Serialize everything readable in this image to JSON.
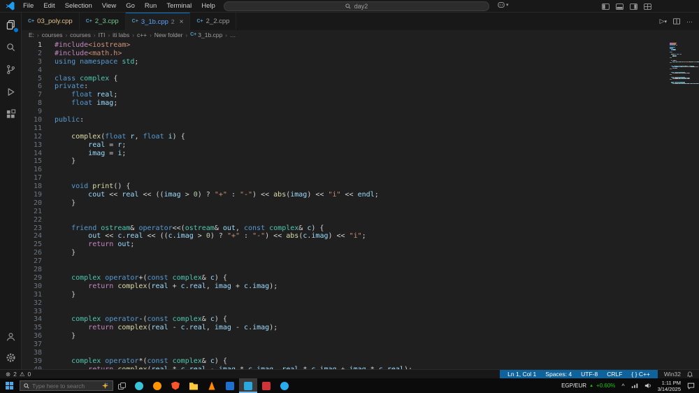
{
  "colors": {
    "accent": "#0078d4",
    "status_section": "#0e639c",
    "ticker_up": "#16c60c",
    "error": "#f14c4c",
    "warning": "#cca700"
  },
  "syntax_colors": {
    "k": "#569CD6",
    "c": "#C586C0",
    "t": "#4EC9B0",
    "v": "#9CDCFE",
    "f": "#DCDCAA",
    "s": "#CE9178",
    "n": "#B5CEA8",
    "p": "#D4D4D4"
  },
  "menu_bar": {
    "items": [
      "File",
      "Edit",
      "Selection",
      "View",
      "Go",
      "Run",
      "Terminal",
      "Help"
    ]
  },
  "command_center": {
    "value": "day2"
  },
  "tabs": [
    {
      "label": "03_poly.cpp",
      "color": "#e2c08d",
      "active": false
    },
    {
      "label": "2_3.cpp",
      "color": "#73c991",
      "active": false
    },
    {
      "label": "3_1b.cpp",
      "suffix": "2",
      "color": "#58a6ff",
      "active": true,
      "close": "×"
    },
    {
      "label": "2_2.cpp",
      "color": "#9d9d9d",
      "active": false
    }
  ],
  "breadcrumb": {
    "items": [
      "E:",
      "courses",
      "courses",
      "ITI",
      "iti labs",
      "c++",
      "New folder",
      "3_1b.cpp",
      "…"
    ],
    "file_index": 7
  },
  "editor": {
    "lines": [
      [
        [
          "#include",
          "c"
        ],
        [
          "<iostream>",
          "s"
        ]
      ],
      [
        [
          "#include",
          "c"
        ],
        [
          "<math.h>",
          "s"
        ]
      ],
      [
        [
          "using",
          "k"
        ],
        [
          " ",
          "p"
        ],
        [
          "namespace",
          "k"
        ],
        [
          " ",
          "p"
        ],
        [
          "std",
          "t"
        ],
        [
          ";",
          "p"
        ]
      ],
      [],
      [
        [
          "class",
          "k"
        ],
        [
          " ",
          "p"
        ],
        [
          "complex",
          "t"
        ],
        [
          " {",
          "p"
        ]
      ],
      [
        [
          "private",
          "k"
        ],
        [
          ":",
          "p"
        ]
      ],
      [
        [
          "    ",
          "p"
        ],
        [
          "float",
          "k"
        ],
        [
          " ",
          "p"
        ],
        [
          "real",
          "v"
        ],
        [
          ";",
          "p"
        ]
      ],
      [
        [
          "    ",
          "p"
        ],
        [
          "float",
          "k"
        ],
        [
          " ",
          "p"
        ],
        [
          "imag",
          "v"
        ],
        [
          ";",
          "p"
        ]
      ],
      [],
      [
        [
          "public",
          "k"
        ],
        [
          ":",
          "p"
        ]
      ],
      [],
      [
        [
          "    ",
          "p"
        ],
        [
          "complex",
          "f"
        ],
        [
          "(",
          "p"
        ],
        [
          "float",
          "k"
        ],
        [
          " ",
          "p"
        ],
        [
          "r",
          "v"
        ],
        [
          ", ",
          "p"
        ],
        [
          "float",
          "k"
        ],
        [
          " ",
          "p"
        ],
        [
          "i",
          "v"
        ],
        [
          ") {",
          "p"
        ]
      ],
      [
        [
          "        ",
          "p"
        ],
        [
          "real",
          "v"
        ],
        [
          " = ",
          "p"
        ],
        [
          "r",
          "v"
        ],
        [
          ";",
          "p"
        ]
      ],
      [
        [
          "        ",
          "p"
        ],
        [
          "imag",
          "v"
        ],
        [
          " = ",
          "p"
        ],
        [
          "i",
          "v"
        ],
        [
          ";",
          "p"
        ]
      ],
      [
        [
          "    }",
          "p"
        ]
      ],
      [],
      [],
      [
        [
          "    ",
          "p"
        ],
        [
          "void",
          "k"
        ],
        [
          " ",
          "p"
        ],
        [
          "print",
          "f"
        ],
        [
          "() {",
          "p"
        ]
      ],
      [
        [
          "        ",
          "p"
        ],
        [
          "cout",
          "v"
        ],
        [
          " << ",
          "p"
        ],
        [
          "real",
          "v"
        ],
        [
          " << ((",
          "p"
        ],
        [
          "imag",
          "v"
        ],
        [
          " > ",
          "p"
        ],
        [
          "0",
          "n"
        ],
        [
          ") ? ",
          "p"
        ],
        [
          "\"+\"",
          "s"
        ],
        [
          " : ",
          "p"
        ],
        [
          "\"-\"",
          "s"
        ],
        [
          ") << ",
          "p"
        ],
        [
          "abs",
          "f"
        ],
        [
          "(",
          "p"
        ],
        [
          "imag",
          "v"
        ],
        [
          ") << ",
          "p"
        ],
        [
          "\"i\"",
          "s"
        ],
        [
          " << ",
          "p"
        ],
        [
          "endl",
          "v"
        ],
        [
          ";",
          "p"
        ]
      ],
      [
        [
          "    }",
          "p"
        ]
      ],
      [],
      [],
      [
        [
          "    ",
          "p"
        ],
        [
          "friend",
          "k"
        ],
        [
          " ",
          "p"
        ],
        [
          "ostream",
          "t"
        ],
        [
          "& ",
          "p"
        ],
        [
          "operator",
          "k"
        ],
        [
          "<<(",
          "p"
        ],
        [
          "ostream",
          "t"
        ],
        [
          "& ",
          "p"
        ],
        [
          "out",
          "v"
        ],
        [
          ", ",
          "p"
        ],
        [
          "const",
          "k"
        ],
        [
          " ",
          "p"
        ],
        [
          "complex",
          "t"
        ],
        [
          "& ",
          "p"
        ],
        [
          "c",
          "v"
        ],
        [
          ") {",
          "p"
        ]
      ],
      [
        [
          "        ",
          "p"
        ],
        [
          "out",
          "v"
        ],
        [
          " << ",
          "p"
        ],
        [
          "c",
          "v"
        ],
        [
          ".",
          "p"
        ],
        [
          "real",
          "v"
        ],
        [
          " << ((",
          "p"
        ],
        [
          "c",
          "v"
        ],
        [
          ".",
          "p"
        ],
        [
          "imag",
          "v"
        ],
        [
          " > ",
          "p"
        ],
        [
          "0",
          "n"
        ],
        [
          ") ? ",
          "p"
        ],
        [
          "\"+\"",
          "s"
        ],
        [
          " : ",
          "p"
        ],
        [
          "\"-\"",
          "s"
        ],
        [
          ") << ",
          "p"
        ],
        [
          "abs",
          "f"
        ],
        [
          "(",
          "p"
        ],
        [
          "c",
          "v"
        ],
        [
          ".",
          "p"
        ],
        [
          "imag",
          "v"
        ],
        [
          ") << ",
          "p"
        ],
        [
          "\"i\"",
          "s"
        ],
        [
          ";",
          "p"
        ]
      ],
      [
        [
          "        ",
          "p"
        ],
        [
          "return",
          "c"
        ],
        [
          " ",
          "p"
        ],
        [
          "out",
          "v"
        ],
        [
          ";",
          "p"
        ]
      ],
      [
        [
          "    }",
          "p"
        ]
      ],
      [],
      [],
      [
        [
          "    ",
          "p"
        ],
        [
          "complex",
          "t"
        ],
        [
          " ",
          "p"
        ],
        [
          "operator",
          "k"
        ],
        [
          "+(",
          "p"
        ],
        [
          "const",
          "k"
        ],
        [
          " ",
          "p"
        ],
        [
          "complex",
          "t"
        ],
        [
          "& ",
          "p"
        ],
        [
          "c",
          "v"
        ],
        [
          ") {",
          "p"
        ]
      ],
      [
        [
          "        ",
          "p"
        ],
        [
          "return",
          "c"
        ],
        [
          " ",
          "p"
        ],
        [
          "complex",
          "f"
        ],
        [
          "(",
          "p"
        ],
        [
          "real",
          "v"
        ],
        [
          " + ",
          "p"
        ],
        [
          "c",
          "v"
        ],
        [
          ".",
          "p"
        ],
        [
          "real",
          "v"
        ],
        [
          ", ",
          "p"
        ],
        [
          "imag",
          "v"
        ],
        [
          " + ",
          "p"
        ],
        [
          "c",
          "v"
        ],
        [
          ".",
          "p"
        ],
        [
          "imag",
          "v"
        ],
        [
          ");",
          "p"
        ]
      ],
      [
        [
          "    }",
          "p"
        ]
      ],
      [],
      [],
      [
        [
          "    ",
          "p"
        ],
        [
          "complex",
          "t"
        ],
        [
          " ",
          "p"
        ],
        [
          "operator",
          "k"
        ],
        [
          "-(",
          "p"
        ],
        [
          "const",
          "k"
        ],
        [
          " ",
          "p"
        ],
        [
          "complex",
          "t"
        ],
        [
          "& ",
          "p"
        ],
        [
          "c",
          "v"
        ],
        [
          ") {",
          "p"
        ]
      ],
      [
        [
          "        ",
          "p"
        ],
        [
          "return",
          "c"
        ],
        [
          " ",
          "p"
        ],
        [
          "complex",
          "f"
        ],
        [
          "(",
          "p"
        ],
        [
          "real",
          "v"
        ],
        [
          " - ",
          "p"
        ],
        [
          "c",
          "v"
        ],
        [
          ".",
          "p"
        ],
        [
          "real",
          "v"
        ],
        [
          ", ",
          "p"
        ],
        [
          "imag",
          "v"
        ],
        [
          " - ",
          "p"
        ],
        [
          "c",
          "v"
        ],
        [
          ".",
          "p"
        ],
        [
          "imag",
          "v"
        ],
        [
          ");",
          "p"
        ]
      ],
      [
        [
          "    }",
          "p"
        ]
      ],
      [],
      [],
      [
        [
          "    ",
          "p"
        ],
        [
          "complex",
          "t"
        ],
        [
          " ",
          "p"
        ],
        [
          "operator",
          "k"
        ],
        [
          "*(",
          "p"
        ],
        [
          "const",
          "k"
        ],
        [
          " ",
          "p"
        ],
        [
          "complex",
          "t"
        ],
        [
          "& ",
          "p"
        ],
        [
          "c",
          "v"
        ],
        [
          ") {",
          "p"
        ]
      ],
      [
        [
          "        ",
          "p"
        ],
        [
          "return",
          "c"
        ],
        [
          " ",
          "p"
        ],
        [
          "complex",
          "f"
        ],
        [
          "(",
          "p"
        ],
        [
          "real",
          "v"
        ],
        [
          " * ",
          "p"
        ],
        [
          "c",
          "v"
        ],
        [
          ".",
          "p"
        ],
        [
          "real",
          "v"
        ],
        [
          " - ",
          "p"
        ],
        [
          "imag",
          "v"
        ],
        [
          " * ",
          "p"
        ],
        [
          "c",
          "v"
        ],
        [
          ".",
          "p"
        ],
        [
          "imag",
          "v"
        ],
        [
          ", ",
          "p"
        ],
        [
          "real",
          "v"
        ],
        [
          " * ",
          "p"
        ],
        [
          "c",
          "v"
        ],
        [
          ".",
          "p"
        ],
        [
          "imag",
          "v"
        ],
        [
          " + ",
          "p"
        ],
        [
          "imag",
          "v"
        ],
        [
          " * ",
          "p"
        ],
        [
          "c",
          "v"
        ],
        [
          ".",
          "p"
        ],
        [
          "real",
          "v"
        ],
        [
          ");",
          "p"
        ]
      ]
    ]
  },
  "status_bar": {
    "errors": "2",
    "warnings": "0",
    "cursor": "Ln 1, Col 1",
    "indent": "Spaces: 4",
    "encoding": "UTF-8",
    "eol": "CRLF",
    "braces": "{ }",
    "language": "C++",
    "config": "Win32"
  },
  "taskbar": {
    "search_placeholder": "Type here to search",
    "apps": [
      {
        "name": "edge",
        "color": "#38c3d8",
        "shape": "circle",
        "active": false
      },
      {
        "name": "firefox",
        "color": "#ff9500",
        "shape": "circle",
        "active": false
      },
      {
        "name": "brave",
        "color": "#fb542b",
        "shape": "shield",
        "active": false
      },
      {
        "name": "file-explorer",
        "color": "#ffca3a",
        "shape": "folder",
        "active": false
      },
      {
        "name": "vlc",
        "color": "#ff8800",
        "shape": "cone",
        "active": false
      },
      {
        "name": "mail",
        "color": "#1e6fd0",
        "shape": "square",
        "active": false
      },
      {
        "name": "vscode",
        "color": "#29a9e0",
        "shape": "square",
        "active": true
      },
      {
        "name": "photos",
        "color": "#d13438",
        "shape": "square",
        "active": false
      },
      {
        "name": "telegram",
        "color": "#2aabee",
        "shape": "circle",
        "active": false
      }
    ],
    "tray": {
      "ticker_pair": "EGP/EUR",
      "ticker_change": "+0.60%",
      "time": "1:11 PM",
      "date": "3/14/2025"
    }
  }
}
